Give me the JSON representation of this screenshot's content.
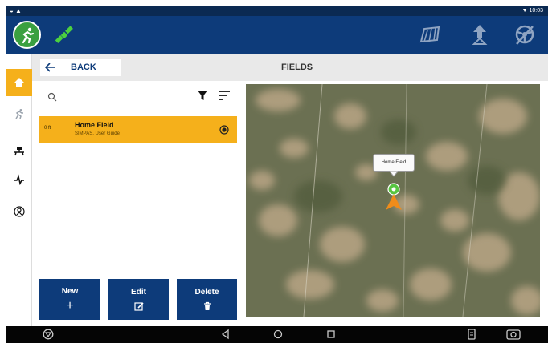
{
  "status_bar": {
    "time": "10:03",
    "left_icons": "◒ ▲"
  },
  "header": {
    "logo_icon": "tractor-figure-icon",
    "gps_icon": "satellite-icon",
    "right_icons": [
      "field-boundary-icon",
      "tower-icon",
      "steering-wheel-icon"
    ]
  },
  "sidebar": {
    "items": [
      {
        "icon": "home-icon",
        "active": true
      },
      {
        "icon": "operator-icon",
        "active": false
      },
      {
        "icon": "implement-icon",
        "active": false
      },
      {
        "icon": "diagnostics-icon",
        "active": false
      },
      {
        "icon": "settings-icon",
        "active": false
      }
    ]
  },
  "topbar": {
    "back_label": "BACK",
    "title": "FIELDS"
  },
  "list": {
    "search_placeholder": "",
    "fields": [
      {
        "distance": "0 ft",
        "name": "Home Field",
        "subtitle": "SIMPAS, User Guide",
        "selected": true
      }
    ]
  },
  "map": {
    "tooltip_label": "Home Field"
  },
  "actions": [
    {
      "label": "New",
      "icon": "plus-icon",
      "symbol": "+"
    },
    {
      "label": "Edit",
      "icon": "edit-icon"
    },
    {
      "label": "Delete",
      "icon": "trash-icon"
    }
  ],
  "colors": {
    "header": "#0d3b7a",
    "accent": "#f5b01b",
    "logo_green": "#3aa040"
  }
}
